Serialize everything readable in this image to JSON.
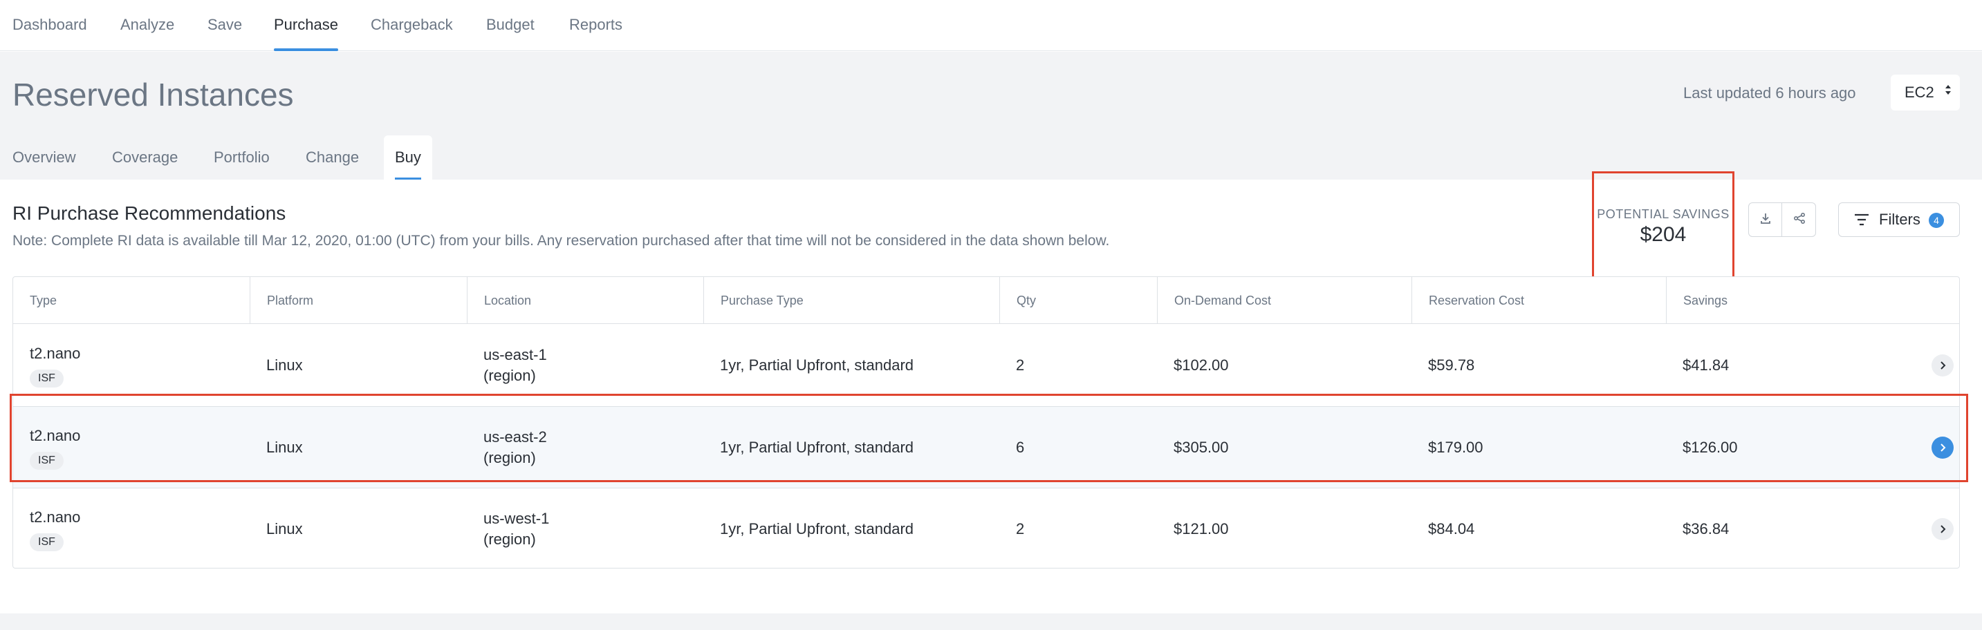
{
  "topnav": {
    "items": [
      {
        "label": "Dashboard"
      },
      {
        "label": "Analyze"
      },
      {
        "label": "Save"
      },
      {
        "label": "Purchase"
      },
      {
        "label": "Chargeback"
      },
      {
        "label": "Budget"
      },
      {
        "label": "Reports"
      }
    ],
    "active": "Purchase"
  },
  "header": {
    "title": "Reserved Instances",
    "last_updated": "Last updated 6 hours ago",
    "service_select": "EC2"
  },
  "subtabs": {
    "items": [
      {
        "label": "Overview"
      },
      {
        "label": "Coverage"
      },
      {
        "label": "Portfolio"
      },
      {
        "label": "Change"
      },
      {
        "label": "Buy"
      }
    ],
    "active": "Buy"
  },
  "section": {
    "title": "RI Purchase Recommendations",
    "note": "Note: Complete RI data is available till Mar 12, 2020, 01:00 (UTC) from your bills. Any reservation purchased after that time will not be considered in the data shown below."
  },
  "savings": {
    "label": "POTENTIAL SAVINGS",
    "value": "$204"
  },
  "filters": {
    "label": "Filters",
    "count": "4"
  },
  "table": {
    "columns": [
      "Type",
      "Platform",
      "Location",
      "Purchase Type",
      "Qty",
      "On-Demand Cost",
      "Reservation Cost",
      "Savings"
    ],
    "rows": [
      {
        "type": "t2.nano",
        "badge": "ISF",
        "platform": "Linux",
        "location": "us-east-1",
        "location_sub": "(region)",
        "purchase_type": "1yr, Partial Upfront, standard",
        "qty": "2",
        "on_demand": "$102.00",
        "reservation": "$59.78",
        "savings": "$41.84"
      },
      {
        "type": "t2.nano",
        "badge": "ISF",
        "platform": "Linux",
        "location": "us-east-2",
        "location_sub": "(region)",
        "purchase_type": "1yr, Partial Upfront, standard",
        "qty": "6",
        "on_demand": "$305.00",
        "reservation": "$179.00",
        "savings": "$126.00"
      },
      {
        "type": "t2.nano",
        "badge": "ISF",
        "platform": "Linux",
        "location": "us-west-1",
        "location_sub": "(region)",
        "purchase_type": "1yr, Partial Upfront, standard",
        "qty": "2",
        "on_demand": "$121.00",
        "reservation": "$84.04",
        "savings": "$36.84"
      }
    ]
  },
  "icons": {
    "download": "download-icon",
    "share": "share-icon",
    "filter": "filter-icon",
    "chevron": "chevron-right-icon",
    "select_arrows": "sort-arrows-icon"
  },
  "colors": {
    "accent": "#3b8fe0",
    "highlight_frame": "#e0442f",
    "muted_text": "#6b7684"
  }
}
